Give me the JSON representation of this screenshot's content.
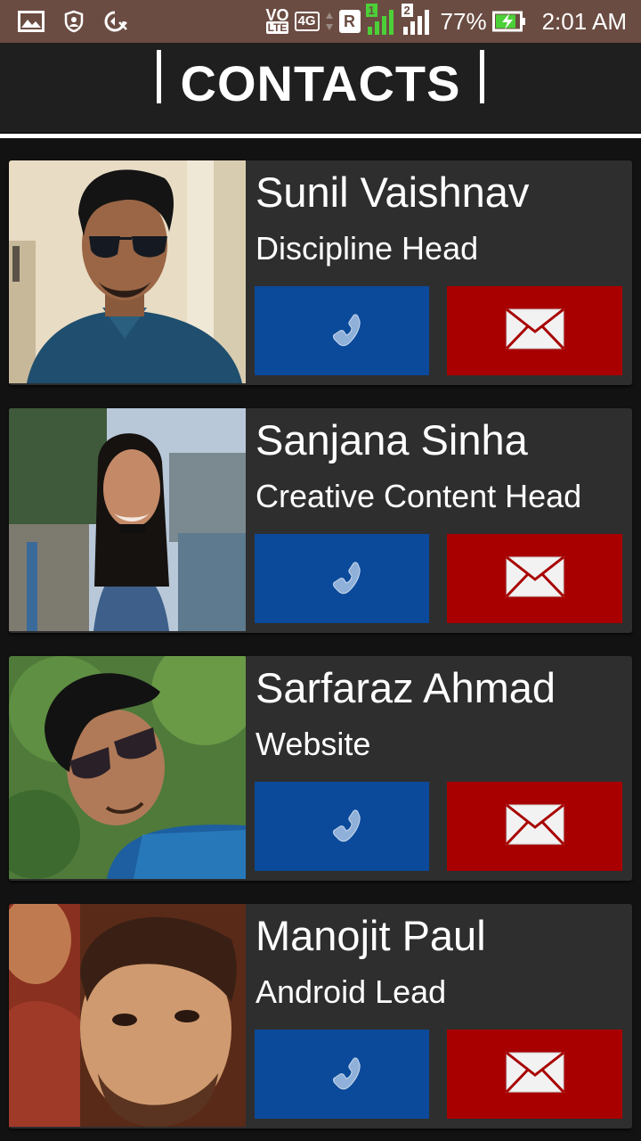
{
  "status_bar": {
    "volte_top": "VO",
    "volte_bottom": "LTE",
    "network": "4G",
    "roaming": "R",
    "sim1": "1",
    "sim2": "2",
    "battery_percent": "77%",
    "time": "2:01 AM",
    "icons": [
      "gallery-icon",
      "shield-icon",
      "data-saver-icon",
      "volte-icon",
      "signal-icon",
      "battery-charging-icon"
    ]
  },
  "header": {
    "title": "CONTACTS"
  },
  "colors": {
    "call_button": "#0b4a9a",
    "mail_button": "#a80000",
    "card_background": "#2e2e2e",
    "status_bar": "#6b4c42"
  },
  "contacts": [
    {
      "name": "Sunil Vaishnav",
      "role": "Discipline Head"
    },
    {
      "name": "Sanjana Sinha",
      "role": "Creative Content Head"
    },
    {
      "name": "Sarfaraz Ahmad",
      "role": "Website"
    },
    {
      "name": "Manojit Paul",
      "role": "Android Lead"
    }
  ]
}
